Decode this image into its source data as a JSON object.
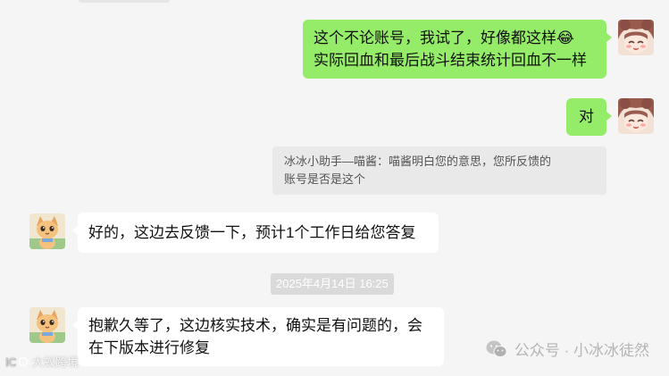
{
  "chat": {
    "messages": [
      {
        "sender": "self",
        "lines": [
          "这个不论账号，我试了，好像都这样😂",
          "实际回血和最后战斗结束统计回血不一样"
        ]
      },
      {
        "sender": "self",
        "lines": [
          "对"
        ]
      },
      {
        "type": "quote",
        "lines": [
          "冰冰小助手—喵酱：喵酱明白您的意思，您所反馈的",
          "账号是否是这个"
        ]
      },
      {
        "sender": "other",
        "lines": [
          "好的，这边去反馈一下，预计1个工作日给您答复"
        ]
      },
      {
        "type": "timestamp",
        "text": "2025年4月14日 16:25"
      },
      {
        "sender": "other",
        "lines": [
          "抱歉久等了，这边核实技术，确实是有问题的，会",
          "在下版本进行修复"
        ]
      }
    ]
  },
  "watermarks": {
    "left": "大蚁跨境",
    "right": "公众号 · 小冰冰徒然"
  },
  "colors": {
    "background": "#f5f5f5",
    "self_bubble": "#95ec69",
    "other_bubble": "#ffffff",
    "quote_bg": "#e9e9e9",
    "timestamp_bg": "#dadada"
  },
  "icons": {
    "self_avatar": "anime-girl-avatar",
    "other_avatar": "cartoon-cat-avatar",
    "wechat_logo": "wechat-icon"
  }
}
